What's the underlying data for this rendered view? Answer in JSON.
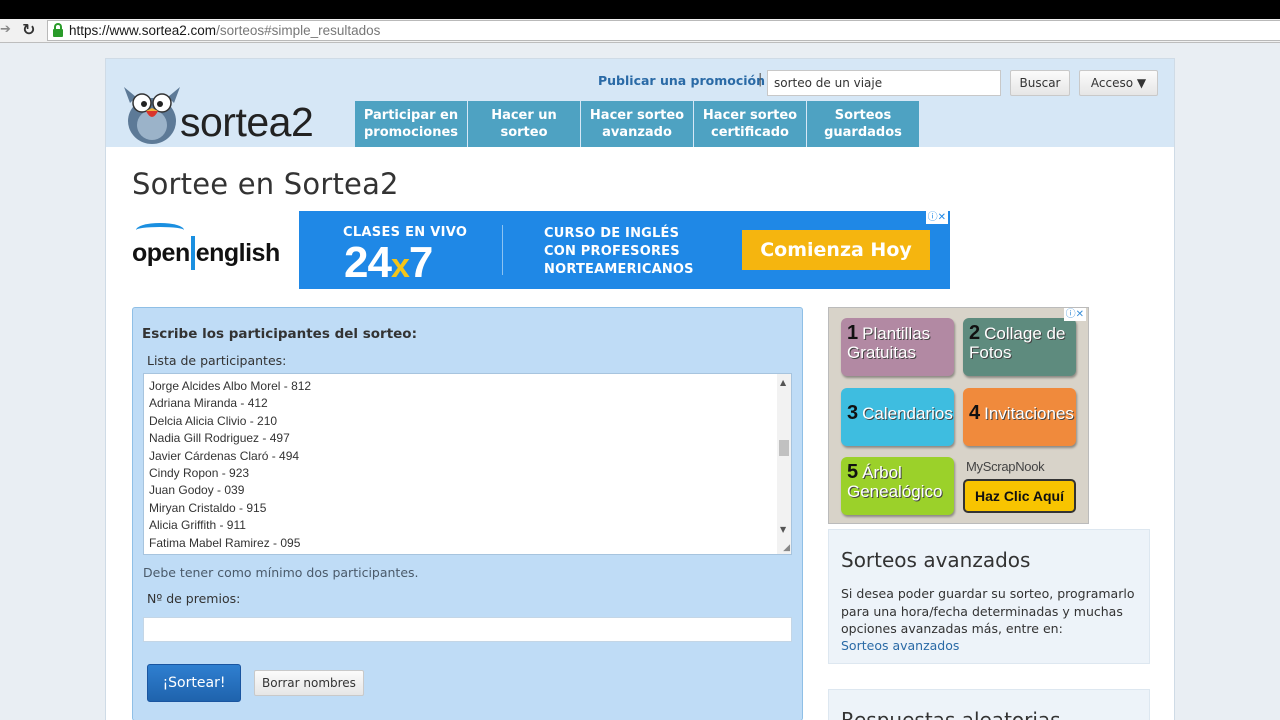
{
  "browser": {
    "url_host": "https://www.sortea2.com",
    "url_path": "/sorteos#simple_resultados"
  },
  "header": {
    "logo_text": "sortea2",
    "publish_link": "Publicar una promoción",
    "separator": "|",
    "search_value": "sorteo de un viaje",
    "search_button": "Buscar",
    "access_button": "Acceso ▼",
    "nav": [
      {
        "label": "Participar en promociones"
      },
      {
        "label": "Hacer un sorteo"
      },
      {
        "label": "Hacer sorteo avanzado"
      },
      {
        "label": "Hacer sorteo certificado"
      },
      {
        "label": "Sorteos guardados"
      }
    ]
  },
  "main": {
    "title": "Sortee en Sortea2",
    "form": {
      "heading": "Escribe los participantes del sorteo:",
      "list_label": "Lista de participantes:",
      "participants": [
        "Jorge Alcides Albo Morel - 812",
        "Adriana Miranda - 412",
        "Delcia Alicia Clivio - 210",
        "Nadia Gill Rodriguez - 497",
        "Javier Cárdenas Claró - 494",
        "Cindy Ropon - 923",
        "Juan Godoy - 039",
        "Miryan Cristaldo - 915",
        "Alicia Griffith - 911",
        "Fatima Mabel Ramirez - 095"
      ],
      "note": "Debe tener como mínimo dos participantes.",
      "prizes_label": "Nº de premios:",
      "prizes_value": "",
      "submit_button": "¡Sortear!",
      "clear_button": "Borrar nombres"
    }
  },
  "ad_banner": {
    "brand_open": "open",
    "brand_english": "english",
    "line1": "CLASES EN VIVO",
    "big_24": "24",
    "big_x": "x",
    "big_7": "7",
    "line2": "CURSO DE INGLÉS",
    "line3": "CON PROFESORES",
    "line4": "NORTEAMERICANOS",
    "cta": "Comienza Hoy",
    "adchoice": "ⓘ✕"
  },
  "ad_side": {
    "tiles": [
      {
        "num": "1",
        "text": "Plantillas Gratuitas"
      },
      {
        "num": "2",
        "text": "Collage de Fotos"
      },
      {
        "num": "3",
        "text": "Calendarios"
      },
      {
        "num": "4",
        "text": "Invitaciones"
      },
      {
        "num": "5",
        "text": "Árbol Genealógico"
      }
    ],
    "brand": "MyScrapNook",
    "cta": "Haz Clic Aquí",
    "adchoice": "ⓘ✕"
  },
  "sidebar": {
    "advanced_title": "Sorteos avanzados",
    "advanced_text": "Si desea poder guardar su sorteo, programarlo para una hora/fecha determinadas y muchas opciones avanzadas más, entre en:",
    "advanced_link": "Sorteos avanzados",
    "random_title": "Respuestas aleatorias"
  },
  "colors": {
    "nav_tab": "#4ea2c2",
    "header_bg": "#d6e7f6",
    "panel_bg": "#bfdcf6",
    "primary_button": "#1f63ad",
    "ad_blue": "#1f88e6",
    "ad_cta": "#f5b50f"
  }
}
